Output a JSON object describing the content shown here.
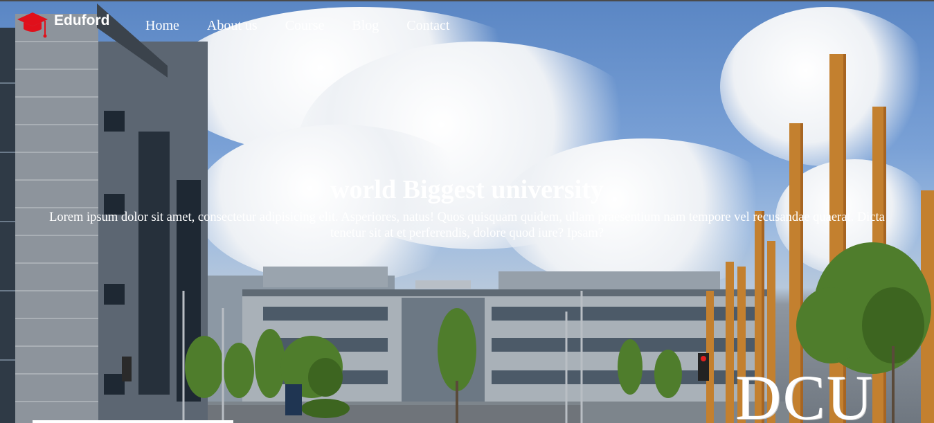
{
  "brand": {
    "name": "Eduford",
    "icon": "graduation-cap-icon",
    "icon_color": "#e0101b"
  },
  "nav": {
    "items": [
      {
        "label": "Home"
      },
      {
        "label": "About us"
      },
      {
        "label": "Course"
      },
      {
        "label": "Blog"
      },
      {
        "label": "Contact"
      }
    ]
  },
  "hero": {
    "title": "world Biggest university",
    "description": "Lorem ipsum dolor sit amet, consectetur adipisicing elit. Asperiores, natus! Quos quisquam quidem, ullam praesentium nam tempore vel recusandae quaerat. Dicta tenetur sit at et perferendis, dolore quod iure? Ipsam?",
    "sign_text": "DCU"
  },
  "colors": {
    "text": "#ffffff",
    "sky": "#5a86c4",
    "accent": "#e0101b"
  }
}
